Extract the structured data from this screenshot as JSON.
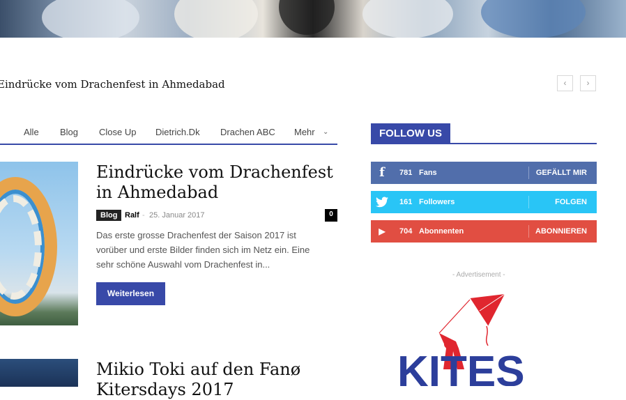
{
  "breadcrumb": "Eindrücke vom Drachenfest in Ahmedabad",
  "nav": {
    "prev": "‹",
    "next": "›"
  },
  "tabs": [
    "Alle",
    "Blog",
    "Close Up",
    "Dietrich.Dk",
    "Drachen ABC",
    "Mehr"
  ],
  "posts": [
    {
      "title": "Eindrücke vom Drachenfest in Ahmedabad",
      "category": "Blog",
      "author": "Ralf",
      "separator": "-",
      "date": "25. Januar 2017",
      "comments": "0",
      "excerpt": "Das erste grosse Drachenfest der Saison 2017 ist vorüber und erste Bilder finden sich im Netz ein. Eine sehr schöne Auswahl vom Drachenfest in...",
      "read_more": "Weiterlesen"
    },
    {
      "title": "Mikio Toki auf den Fanø Kitersdays 2017"
    }
  ],
  "follow": {
    "title": "FOLLOW US",
    "networks": [
      {
        "icon": "facebook-icon",
        "glyph": "f",
        "count": "781",
        "label": "Fans",
        "action": "GEFÄLLT MIR",
        "color": "#516eab"
      },
      {
        "icon": "twitter-icon",
        "glyph": "t",
        "count": "161",
        "label": "Followers",
        "action": "FOLGEN",
        "color": "#29c5f6"
      },
      {
        "icon": "youtube-icon",
        "glyph": "▶",
        "count": "704",
        "label": "Abonnenten",
        "action": "ABONNIEREN",
        "color": "#e14e42"
      }
    ]
  },
  "ad": {
    "label": "- Advertisement -",
    "logo_text": "KITES"
  },
  "colors": {
    "accent": "#3849a8"
  }
}
